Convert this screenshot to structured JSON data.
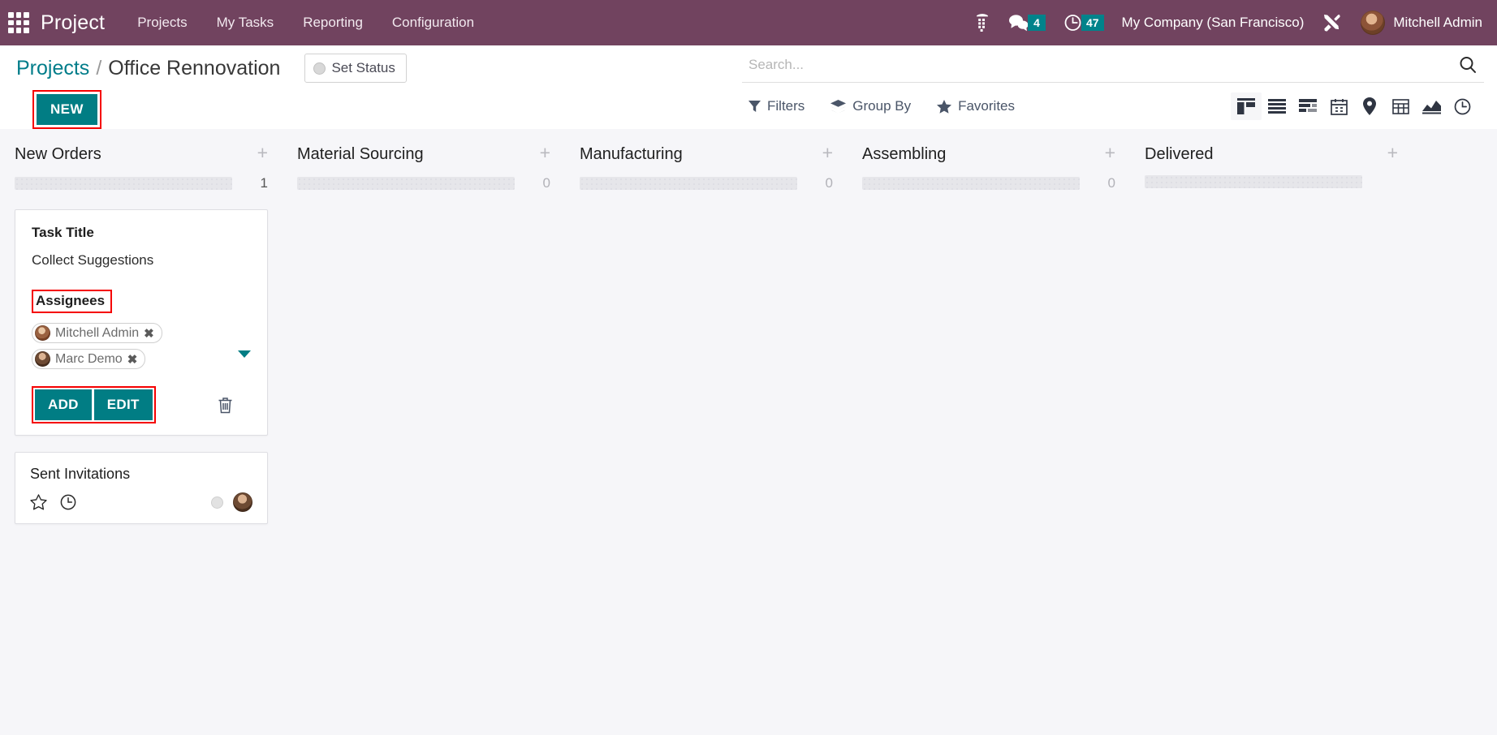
{
  "navbar": {
    "apps_icon": "apps-grid-icon",
    "brand": "Project",
    "menu": [
      {
        "label": "Projects"
      },
      {
        "label": "My Tasks"
      },
      {
        "label": "Reporting"
      },
      {
        "label": "Configuration"
      }
    ],
    "voip_icon": "phone-dialpad-icon",
    "messages_icon": "chat-bubble-icon",
    "messages_count": "4",
    "activities_icon": "clock-icon",
    "activities_count": "47",
    "company": "My Company (San Francisco)",
    "tools_icon": "tools-icon",
    "user_avatar": "user-avatar",
    "user_name": "Mitchell Admin",
    "badge_color": "#01838b",
    "background_color": "#71435f"
  },
  "control_panel": {
    "breadcrumb": {
      "parent": "Projects",
      "separator": "/",
      "current": "Office Rennovation"
    },
    "set_status_label": "Set Status",
    "set_status_icon": "status-circle-icon",
    "new_button": "NEW",
    "search": {
      "placeholder": "Search...",
      "value": "",
      "icon": "search-icon"
    },
    "filters": [
      {
        "label": "Filters",
        "icon": "funnel-icon"
      },
      {
        "label": "Group By",
        "icon": "layers-icon"
      },
      {
        "label": "Favorites",
        "icon": "star-icon"
      }
    ],
    "views": [
      {
        "name": "kanban-view",
        "icon": "kanban-icon",
        "active": true
      },
      {
        "name": "list-view",
        "icon": "list-icon",
        "active": false
      },
      {
        "name": "activity-view",
        "icon": "activity-icon",
        "active": false
      },
      {
        "name": "calendar-view",
        "icon": "calendar-icon",
        "active": false
      },
      {
        "name": "map-view",
        "icon": "map-pin-icon",
        "active": false
      },
      {
        "name": "pivot-view",
        "icon": "pivot-table-icon",
        "active": false
      },
      {
        "name": "graph-view",
        "icon": "graph-icon",
        "active": false
      },
      {
        "name": "timesheet-view",
        "icon": "clock-icon",
        "active": false
      }
    ]
  },
  "kanban": {
    "columns": [
      {
        "title": "New Orders",
        "count": "1",
        "add_icon": "plus-icon"
      },
      {
        "title": "Material Sourcing",
        "count": "0",
        "add_icon": "plus-icon"
      },
      {
        "title": "Manufacturing",
        "count": "0",
        "add_icon": "plus-icon"
      },
      {
        "title": "Assembling",
        "count": "0",
        "add_icon": "plus-icon"
      },
      {
        "title": "Delivered",
        "count": "",
        "add_icon": "plus-icon"
      }
    ],
    "edit_card": {
      "task_title_label": "Task Title",
      "task_title_value": "Collect Suggestions",
      "assignees_label": "Assignees",
      "assignees": [
        {
          "name": "Mitchell Admin",
          "remove_icon": "remove-tag-icon"
        },
        {
          "name": "Marc Demo",
          "remove_icon": "remove-tag-icon"
        }
      ],
      "dropdown_icon": "chevron-down-icon",
      "add_label": "ADD",
      "edit_label": "EDIT",
      "delete_icon": "trash-icon",
      "button_color": "#017d84",
      "highlight_color": "#f50000"
    },
    "simple_card": {
      "title": "Sent Invitations",
      "star_icon": "star-outline-icon",
      "clock_icon": "clock-icon",
      "state_icon": "kanban-state-circle-icon",
      "avatar": "assignee-avatar"
    }
  }
}
